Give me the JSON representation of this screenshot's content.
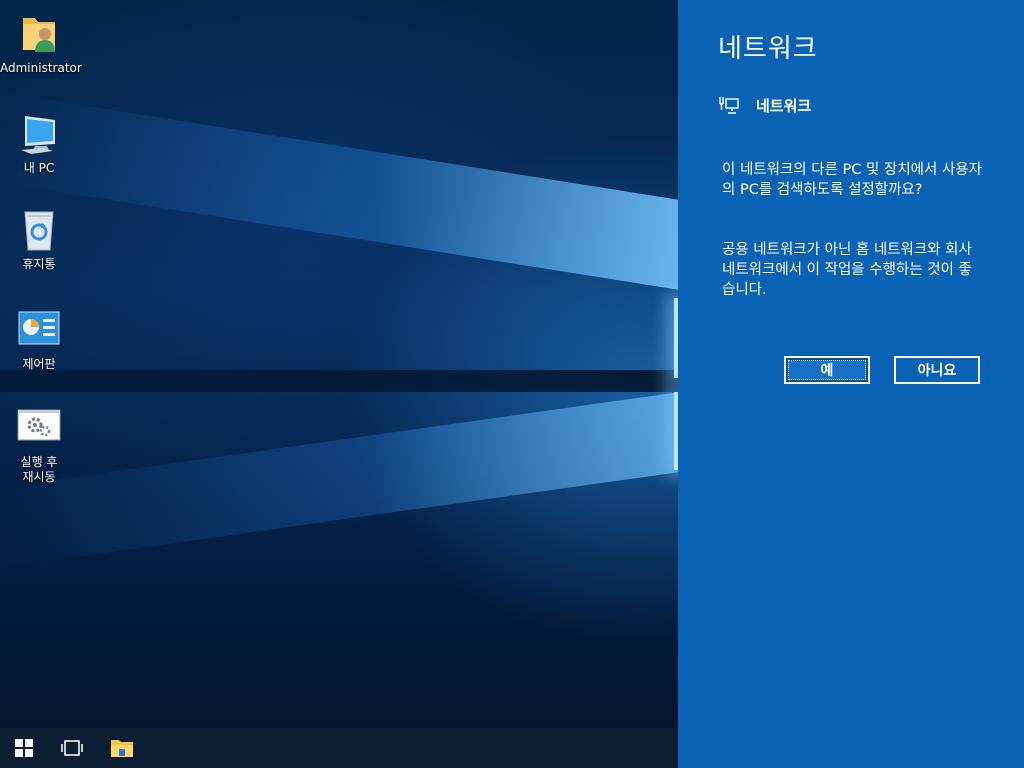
{
  "desktop": {
    "icons": [
      {
        "label": "Administrator",
        "icon": "user-folder-icon"
      },
      {
        "label": "내 PC",
        "icon": "computer-icon"
      },
      {
        "label": "휴지통",
        "icon": "recycle-bin-icon"
      },
      {
        "label": "제어판",
        "icon": "control-panel-icon"
      },
      {
        "label_line1": "실행 후",
        "label_line2": "재시동",
        "icon": "gears-icon"
      }
    ]
  },
  "taskbar": {
    "items": [
      "windows-start-icon",
      "task-view-icon",
      "file-explorer-icon"
    ]
  },
  "network_panel": {
    "title": "네트워크",
    "network_name": "네트워크",
    "message1": "이 네트워크의 다른 PC 및 장치에서 사용자의 PC를 검색하도록 설정할까요?",
    "message2": "공용 네트워크가 아닌 홈 네트워크와 회사 네트워크에서 이 작업을 수행하는 것이 좋습니다.",
    "yes_label": "예",
    "no_label": "아니요",
    "accent": "#0a62b4"
  }
}
